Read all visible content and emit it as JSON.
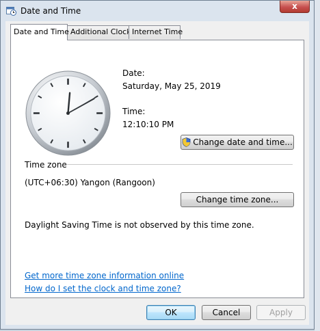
{
  "window": {
    "title": "Date and Time",
    "close_glyph": "x"
  },
  "tabs": [
    {
      "label": "Date and Time",
      "active": true
    },
    {
      "label": "Additional Clocks",
      "active": false
    },
    {
      "label": "Internet Time",
      "active": false
    }
  ],
  "clock": {
    "hour": 12,
    "minute": 10,
    "second": 10
  },
  "date": {
    "label": "Date:",
    "value": "Saturday, May 25, 2019"
  },
  "time": {
    "label": "Time:",
    "value": "12:10:10 PM"
  },
  "change_datetime_button": {
    "label": "Change date and time...",
    "icon": "uac-shield-icon"
  },
  "timezone": {
    "section_label": "Time zone",
    "value": "(UTC+06:30) Yangon (Rangoon)",
    "change_button_label": "Change time zone...",
    "dst_note": "Daylight Saving Time is not observed by this time zone."
  },
  "links": {
    "more_info": "Get more time zone information online",
    "how_to": "How do I set the clock and time zone?"
  },
  "footer": {
    "ok": "OK",
    "cancel": "Cancel",
    "apply": "Apply"
  },
  "colors": {
    "link": "#0066cc",
    "close": "#c75050",
    "default_button_border": "#3c7fb1"
  }
}
